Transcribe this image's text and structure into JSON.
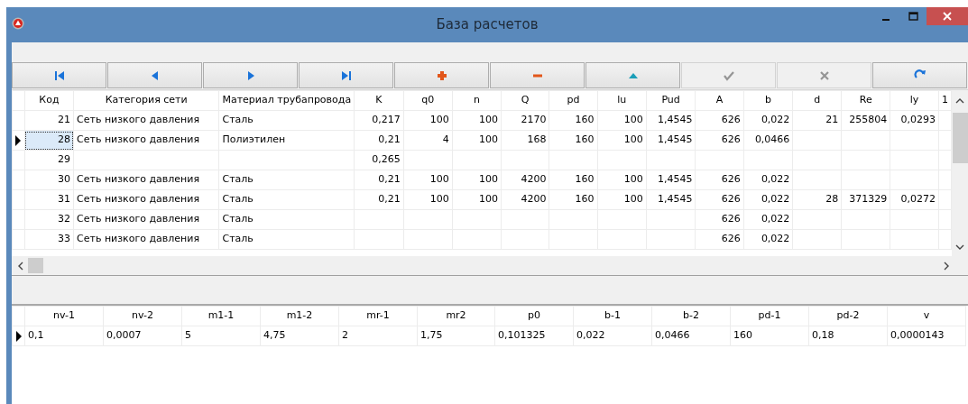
{
  "window": {
    "title": "База расчетов"
  },
  "toolbar": [
    {
      "kind": "first",
      "disabled": false
    },
    {
      "kind": "prior",
      "disabled": false
    },
    {
      "kind": "next",
      "disabled": false
    },
    {
      "kind": "last",
      "disabled": false
    },
    {
      "kind": "insert",
      "disabled": false
    },
    {
      "kind": "delete",
      "disabled": false
    },
    {
      "kind": "edit",
      "disabled": false
    },
    {
      "kind": "post",
      "disabled": true
    },
    {
      "kind": "cancel",
      "disabled": true
    },
    {
      "kind": "refresh",
      "disabled": false
    }
  ],
  "main_grid": {
    "columns": [
      "Код",
      "Категория сети",
      "Материал трубапровода",
      "K",
      "q0",
      "n",
      "Q",
      "pd",
      "lu",
      "Pud",
      "A",
      "b",
      "d",
      "Re",
      "ly",
      "1"
    ],
    "rows": [
      {
        "selected": false,
        "cells": [
          "21",
          "Сеть низкого давления",
          "Сталь",
          "0,217",
          "100",
          "100",
          "2170",
          "160",
          "100",
          "1,4545",
          "626",
          "0,022",
          "21",
          "255804",
          "0,0293",
          null
        ]
      },
      {
        "selected": true,
        "cells": [
          "28",
          "Сеть низкого давления",
          "Полиэтилен",
          "0,21",
          "4",
          "100",
          "168",
          "160",
          "100",
          "1,4545",
          "626",
          "0,0466",
          null,
          null,
          null,
          null
        ]
      },
      {
        "selected": false,
        "cells": [
          "29",
          null,
          null,
          "0,265",
          null,
          null,
          null,
          null,
          null,
          null,
          null,
          null,
          null,
          null,
          null,
          null
        ]
      },
      {
        "selected": false,
        "cells": [
          "30",
          "Сеть низкого давления",
          "Сталь",
          "0,21",
          "100",
          "100",
          "4200",
          "160",
          "100",
          "1,4545",
          "626",
          "0,022",
          null,
          null,
          null,
          null
        ]
      },
      {
        "selected": false,
        "cells": [
          "31",
          "Сеть низкого давления",
          "Сталь",
          "0,21",
          "100",
          "100",
          "4200",
          "160",
          "100",
          "1,4545",
          "626",
          "0,022",
          "28",
          "371329",
          "0,0272",
          null
        ]
      },
      {
        "selected": false,
        "cells": [
          "32",
          "Сеть низкого давления",
          "Сталь",
          null,
          null,
          null,
          null,
          null,
          null,
          null,
          "626",
          "0,022",
          null,
          null,
          null,
          null
        ]
      },
      {
        "selected": false,
        "cells": [
          "33",
          "Сеть низкого давления",
          "Сталь",
          null,
          null,
          null,
          null,
          null,
          null,
          null,
          "626",
          "0,022",
          null,
          null,
          null,
          null
        ]
      }
    ]
  },
  "params_grid": {
    "columns": [
      "nv-1",
      "nv-2",
      "m1-1",
      "m1-2",
      "mr-1",
      "mr2",
      "p0",
      "b-1",
      "b-2",
      "pd-1",
      "pd-2",
      "v"
    ],
    "rows": [
      {
        "selected": true,
        "cells": [
          "0,1",
          "0,0007",
          "5",
          "4,75",
          "2",
          "1,75",
          "0,101325",
          "0,022",
          "0,0466",
          "160",
          "0,18",
          "0,0000143"
        ]
      }
    ]
  }
}
